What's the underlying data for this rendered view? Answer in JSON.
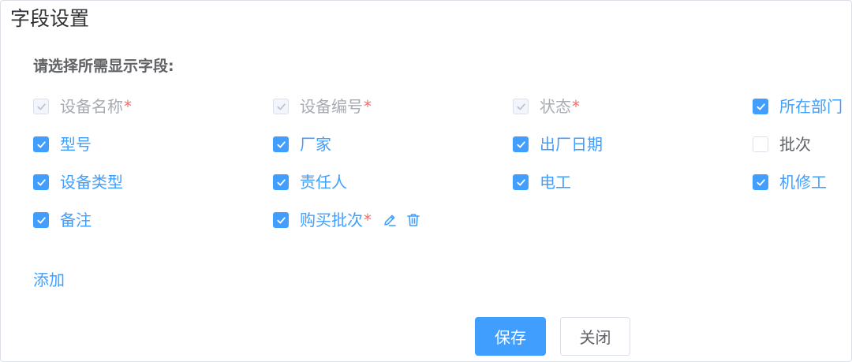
{
  "dialog": {
    "title": "字段设置",
    "section_label": "请选择所需显示字段:",
    "add_label": "添加",
    "save_label": "保存",
    "close_label": "关闭"
  },
  "colors": {
    "primary": "#409eff",
    "required": "#f56c6c",
    "disabled_text": "#a8abb2"
  },
  "fields": [
    {
      "label": "设备名称",
      "required": "*",
      "state": "locked"
    },
    {
      "label": "设备编号",
      "required": "*",
      "state": "locked"
    },
    {
      "label": "状态",
      "required": "*",
      "state": "locked"
    },
    {
      "label": "所在部门",
      "required": "",
      "state": "checked"
    },
    {
      "label": "型号",
      "required": "",
      "state": "checked"
    },
    {
      "label": "厂家",
      "required": "",
      "state": "checked"
    },
    {
      "label": "出厂日期",
      "required": "",
      "state": "checked"
    },
    {
      "label": "批次",
      "required": "",
      "state": "unchecked"
    },
    {
      "label": "设备类型",
      "required": "",
      "state": "checked"
    },
    {
      "label": "责任人",
      "required": "",
      "state": "checked"
    },
    {
      "label": "电工",
      "required": "",
      "state": "checked"
    },
    {
      "label": "机修工",
      "required": "",
      "state": "checked"
    },
    {
      "label": "备注",
      "required": "",
      "state": "checked"
    },
    {
      "label": "购买批次",
      "required": "*",
      "state": "checked",
      "editable": true
    }
  ],
  "icons": {
    "edit": "pencil-icon",
    "delete": "trash-icon",
    "check": "checkmark-icon"
  }
}
